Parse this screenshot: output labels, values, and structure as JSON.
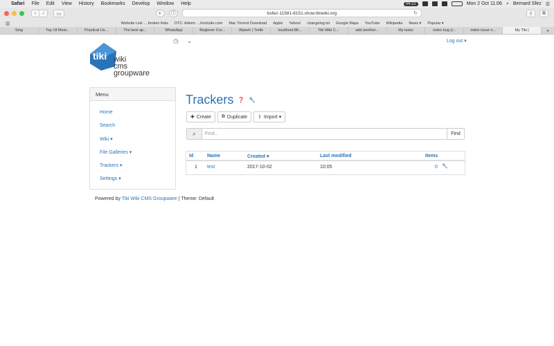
{
  "menubar": {
    "app": "Safari",
    "items": [
      "File",
      "Edit",
      "View",
      "History",
      "Bookmarks",
      "Develop",
      "Window",
      "Help"
    ],
    "clock": "Mon 2 Oct 11:06",
    "user": "Bernard Sfez",
    "timer": "04:22"
  },
  "browser": {
    "url": "bsfez-11581-6151.show.tikiwiki.org",
    "bookmarks": [
      "Website Link ... broken links",
      "DTC: Admin: ...hocksite.com",
      "Mac Torrent Download",
      "Apple",
      "Yahoo!",
      "changelog.txt",
      "Google Maps",
      "YouTube",
      "Wikipedia",
      "News ▾",
      "Popular ▾"
    ],
    "tabs": [
      "Sing",
      "Top 18 Most...",
      "Practical Us...",
      "The best ap...",
      "WhatsApp",
      "Beginner Cre...",
      "Alaeeh | Trello",
      "localhost:88...",
      "Tiki Wiki C...",
      "add another...",
      "My tasks",
      "index bug (r...",
      "index issue o...",
      "My Tiki |"
    ]
  },
  "header": {
    "logo": {
      "badge": "tiki",
      "line1": "wiki",
      "line2": "cms",
      "line3": "groupware"
    },
    "logout": "Log out ▾"
  },
  "menu": {
    "title": "Menu",
    "items": [
      "Home",
      "Search",
      "Wiki ▾",
      "File Galleries ▾",
      "Trackers ▾",
      "Settings ▾"
    ]
  },
  "main": {
    "title": "Trackers",
    "buttons": {
      "create": "Create",
      "duplicate": "Duplicate",
      "import": "Import ▾"
    },
    "search": {
      "placeholder": "Find...",
      "button": "Find"
    },
    "table": {
      "headers": {
        "id": "Id",
        "name": "Name",
        "created": "Created",
        "modified": "Last modified",
        "items": "Items"
      },
      "rows": [
        {
          "id": "1",
          "name": "test",
          "created": "2017-10-02",
          "modified": "10:05",
          "items": "0"
        }
      ]
    }
  },
  "footer": {
    "prefix": "Powered by",
    "link": "Tiki Wiki CMS Groupware",
    "theme": "| Theme: Default"
  },
  "colors": {
    "link": "#2a73b8",
    "logo": "#2a73b8"
  }
}
